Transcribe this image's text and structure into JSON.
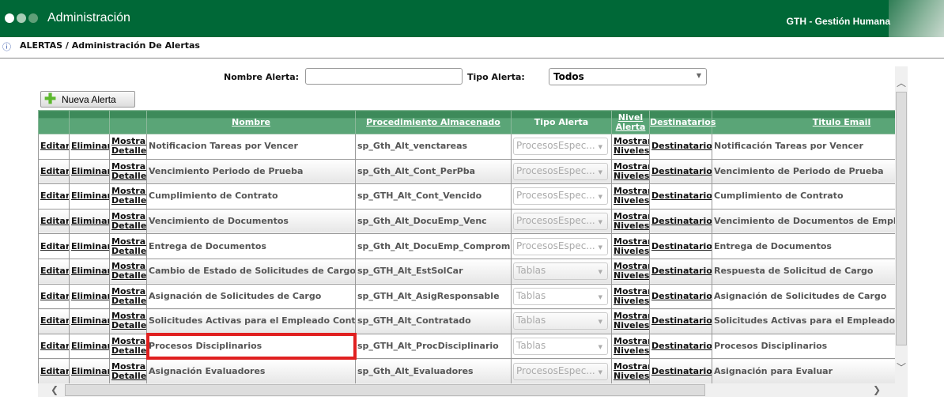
{
  "header": {
    "title": "Administración",
    "brand": "GTH - Gestión Humana",
    "color": "#006837"
  },
  "breadcrumb": "ALERTAS / Administración De Alertas",
  "filters": {
    "nombre_label": "Nombre Alerta:",
    "nombre_value": "",
    "tipo_label": "Tipo Alerta:",
    "tipo_value": "Todos"
  },
  "new_button": "Nueva Alerta",
  "columns": [
    "",
    "",
    "",
    "Nombre",
    "Procedimiento Almacenado",
    "Tipo Alerta",
    "Nivel Alerta",
    "Destinatarios",
    "Titulo Email"
  ],
  "row_links": {
    "edit": "Editar",
    "delete": "Eliminar",
    "detail1": "Mostrar",
    "detail2": "Detalle",
    "levels1": "Mostrar",
    "levels2": "Niveles",
    "recipients": "Destinatarios"
  },
  "rows": [
    {
      "nombre": "Notificacion Tareas por Vencer",
      "proc": "sp_Gth_Alt_venctareas",
      "tipo": "ProcesosEspec...",
      "titulo": "Notificación Tareas por Vencer"
    },
    {
      "nombre": "Vencimiento Periodo de Prueba",
      "proc": "sp_Gth_Alt_Cont_PerPba",
      "tipo": "ProcesosEspec...",
      "titulo": "Vencimiento de Periodo de Prueba"
    },
    {
      "nombre": "Cumplimiento de Contrato",
      "proc": "sp_GTH_Alt_Cont_Vencido",
      "tipo": "ProcesosEspec...",
      "titulo": "Cumplimiento de Contrato"
    },
    {
      "nombre": "Vencimiento de Documentos",
      "proc": "sp_Gth_Alt_DocuEmp_Venc",
      "tipo": "ProcesosEspec...",
      "titulo": "Vencimiento de Documentos de Empleados"
    },
    {
      "nombre": "Entrega de Documentos",
      "proc": "sp_Gth_Alt_DocuEmp_Compromiso",
      "tipo": "ProcesosEspec...",
      "titulo": "Entrega de Documentos"
    },
    {
      "nombre": "Cambio de Estado de Solicitudes de Cargos",
      "proc": "sp_GTH_Alt_EstSolCar",
      "tipo": "Tablas",
      "titulo": "Respuesta de Solicitud de Cargo"
    },
    {
      "nombre": "Asignación de Solicitudes de Cargo",
      "proc": "sp_GTH_Alt_AsigResponsable",
      "tipo": "Tablas",
      "titulo": "Asignación de Solicitudes de Cargo"
    },
    {
      "nombre": "Solicitudes Activas para el Empleado Contratado",
      "proc": "sp_GTH_Alt_Contratado",
      "tipo": "Tablas",
      "titulo": "Solicitudes Activas para el Empleado Contratado"
    },
    {
      "nombre": "Procesos Disciplinarios",
      "proc": "sp_GTH_Alt_ProcDisciplinario",
      "tipo": "Tablas",
      "titulo": "Procesos Disciplinarios",
      "highlighted": true
    },
    {
      "nombre": "Asignación Evaluadores",
      "proc": "sp_Gth_Alt_Evaluadores",
      "tipo": "ProcesosEspec...",
      "titulo": "Asignación para Evaluar"
    }
  ]
}
